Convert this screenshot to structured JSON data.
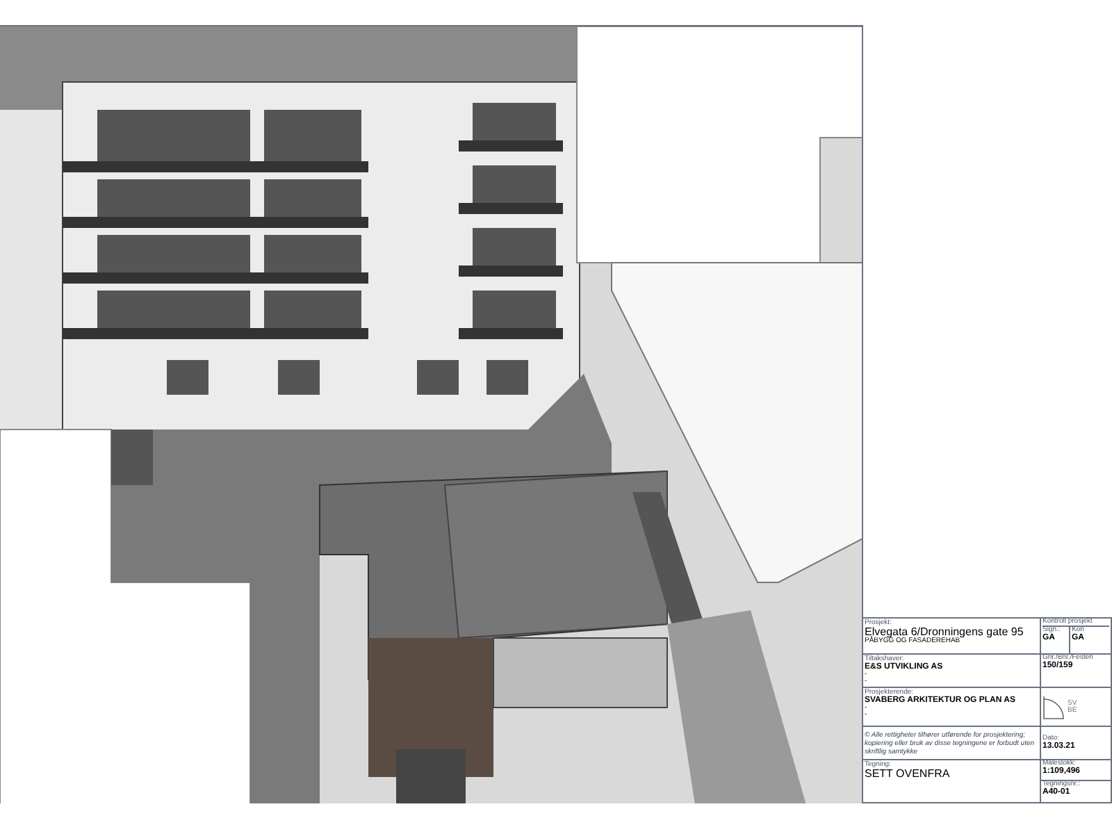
{
  "title_block": {
    "project_label": "Prosjekt:",
    "project": "Elvegata 6/Dronningens gate 95",
    "subtitle": "PÅBYGG OG FASADEREHAB",
    "client_label": "Tiltakshaver:",
    "client": "E&S UTVIKLING AS",
    "client_lines": [
      "-",
      "-"
    ],
    "designer_label": "Prosjekterende:",
    "designer": "SVABERG ARKITEKTUR OG PLAN AS",
    "designer_lines": [
      "-",
      "-"
    ],
    "copyright": "© Alle rettigheter tilhører utførende for prosjektering; kopiering eller bruk av disse tegningene er forbudt uten skriftlig samtykke",
    "drawing_label": "Tegning:",
    "drawing_title": "SETT OVENFRA",
    "control_label": "Kontroll prosjekt",
    "sign_label": "Sign.:",
    "sign": "GA",
    "check_label": "Kon",
    "check": "GA",
    "property_label": "Gnr./Bnr./Festen",
    "property": "150/159",
    "logo_text": [
      "SV",
      "BE"
    ],
    "date_label": "Dato:",
    "date": "13.03.21",
    "scale_label": "Målestokk:",
    "scale": "1:109,496",
    "number_label": "Tegningsnr.:",
    "number": "A40-01"
  }
}
